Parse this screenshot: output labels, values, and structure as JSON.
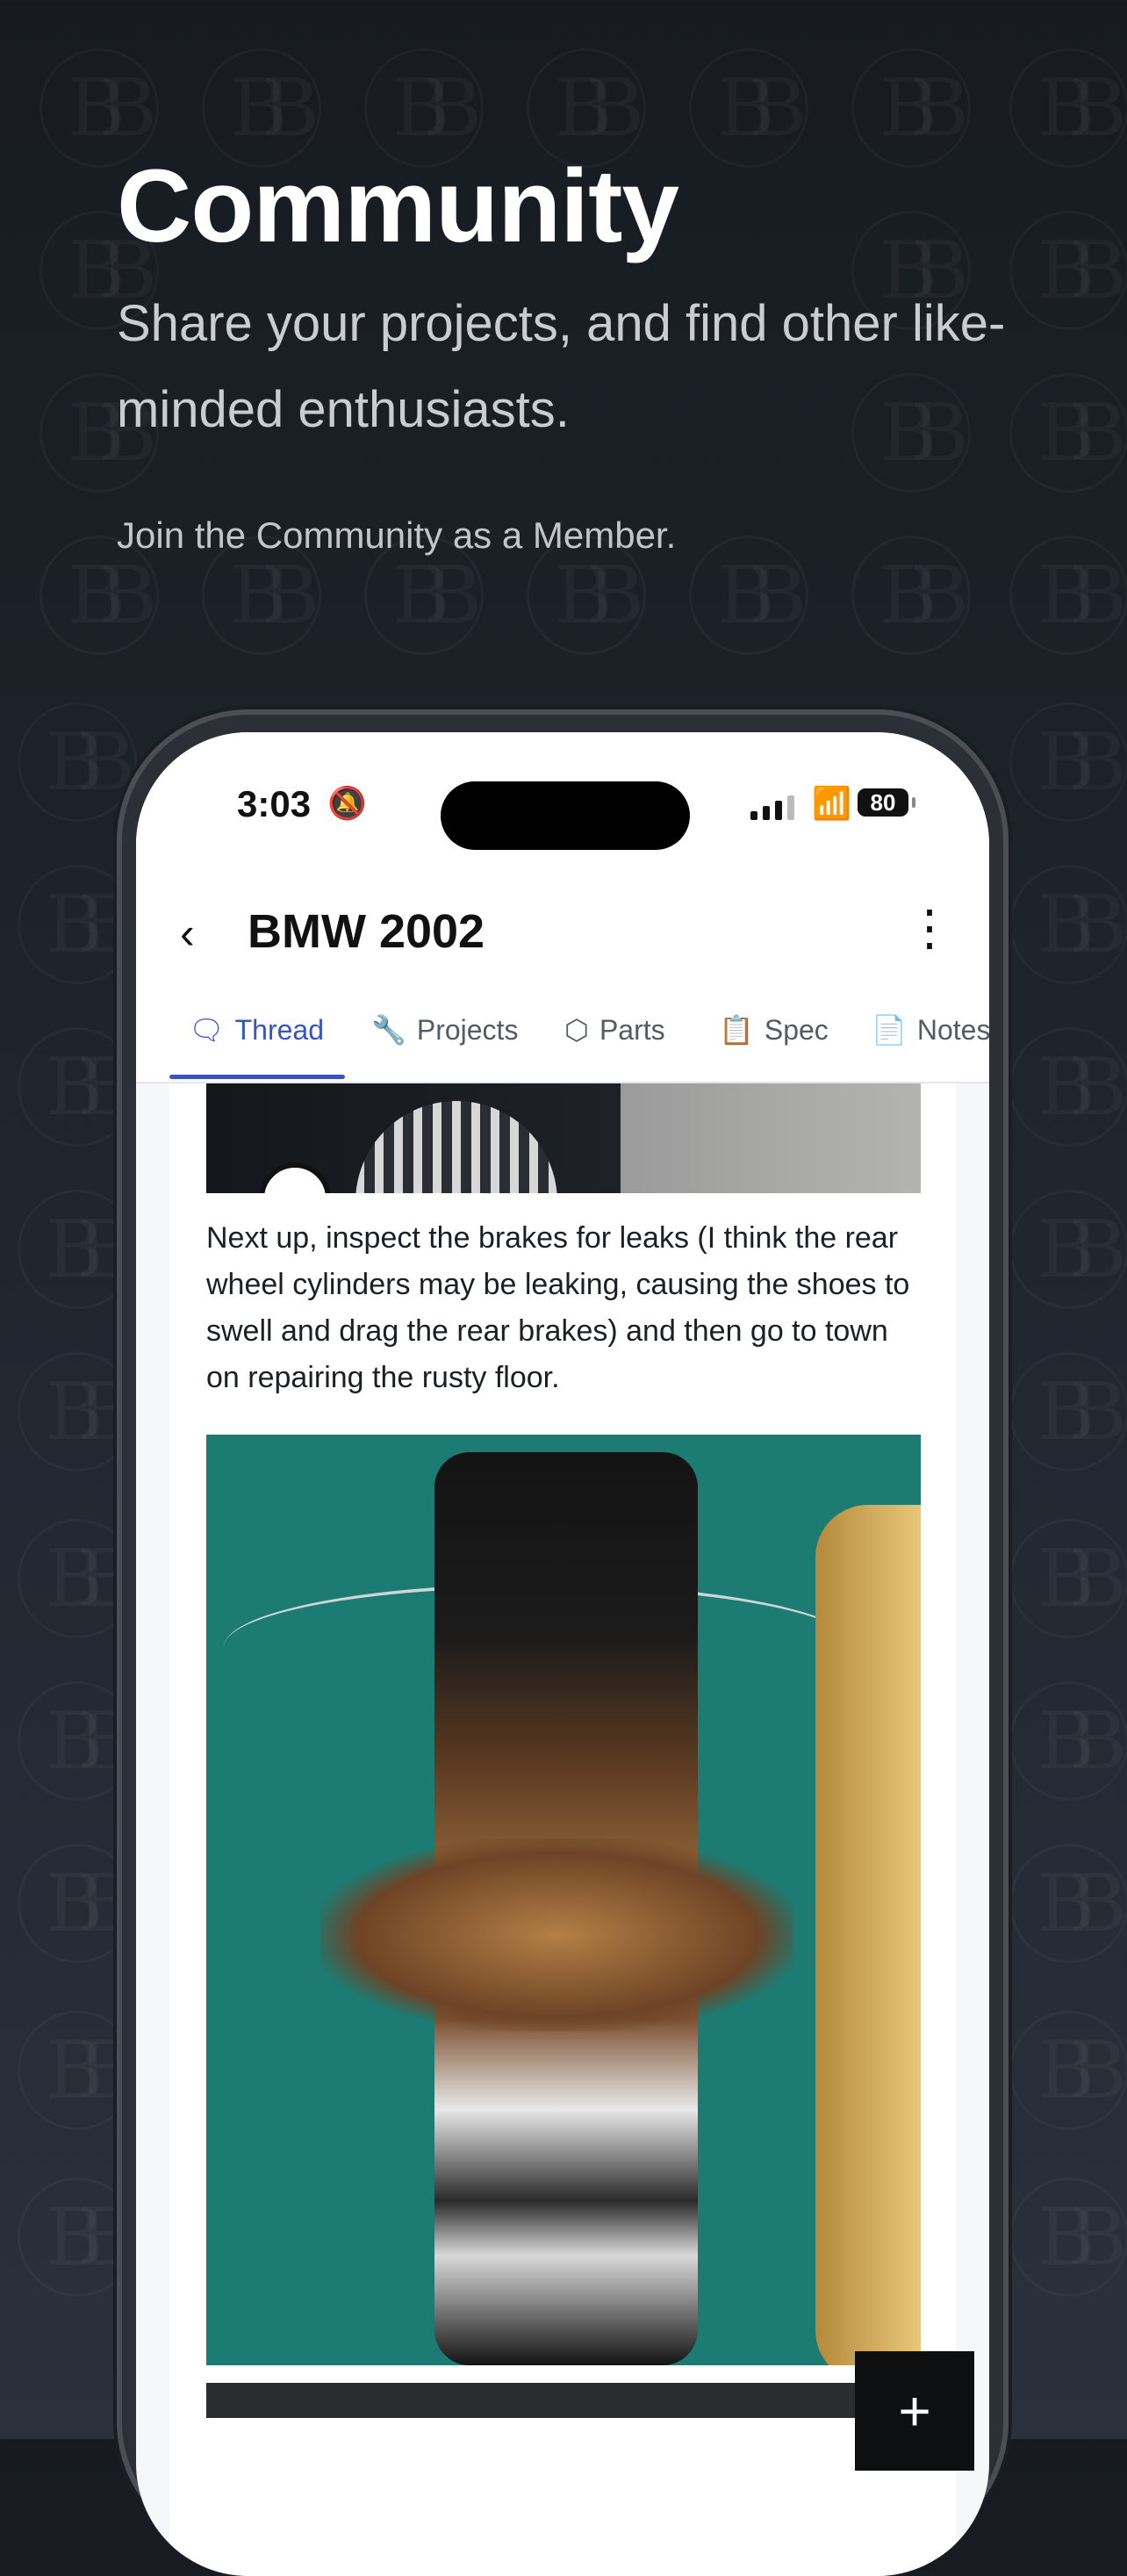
{
  "hero": {
    "title": "Community",
    "subtitle": "Share your projects, and find other like-minded enthusiasts.",
    "join_text": "Join the Community as a Member."
  },
  "status_bar": {
    "time": "3:03",
    "battery": "80"
  },
  "header": {
    "back_icon": "chevron-left-icon",
    "title": "BMW 2002",
    "more_icon": "more-vertical-icon"
  },
  "tabs": [
    {
      "label": "Thread",
      "icon": "chat-icon",
      "active": true
    },
    {
      "label": "Projects",
      "icon": "wrench-icon",
      "active": false
    },
    {
      "label": "Parts",
      "icon": "box-icon",
      "active": false
    },
    {
      "label": "Spec",
      "icon": "clipboard-icon",
      "active": false
    },
    {
      "label": "Notes",
      "icon": "document-icon",
      "active": false
    }
  ],
  "thread": {
    "paragraph": "Next up, inspect the brakes for leaks (I think the rear wheel cylinders may be leaking, causing the shoes to swell and drag the rear brakes) and then go to town on repairing the rusty floor."
  },
  "fab": {
    "label": "+"
  },
  "colors": {
    "accent": "#3653c9",
    "background": "#1f252d"
  }
}
